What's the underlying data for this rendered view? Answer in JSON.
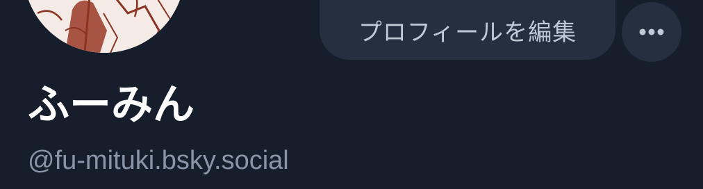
{
  "profile": {
    "display_name": "ふーみん",
    "handle": "@fu-mituki.bsky.social",
    "avatar_icon": "avatar-illustration"
  },
  "actions": {
    "edit_profile_label": "プロフィールを編集",
    "more_icon": "ellipsis-icon"
  },
  "colors": {
    "background": "#161e2b",
    "button_bg": "#262f3f",
    "button_text": "#c0c9d6",
    "name_text": "#ffffff",
    "handle_text": "#8a96a8"
  }
}
